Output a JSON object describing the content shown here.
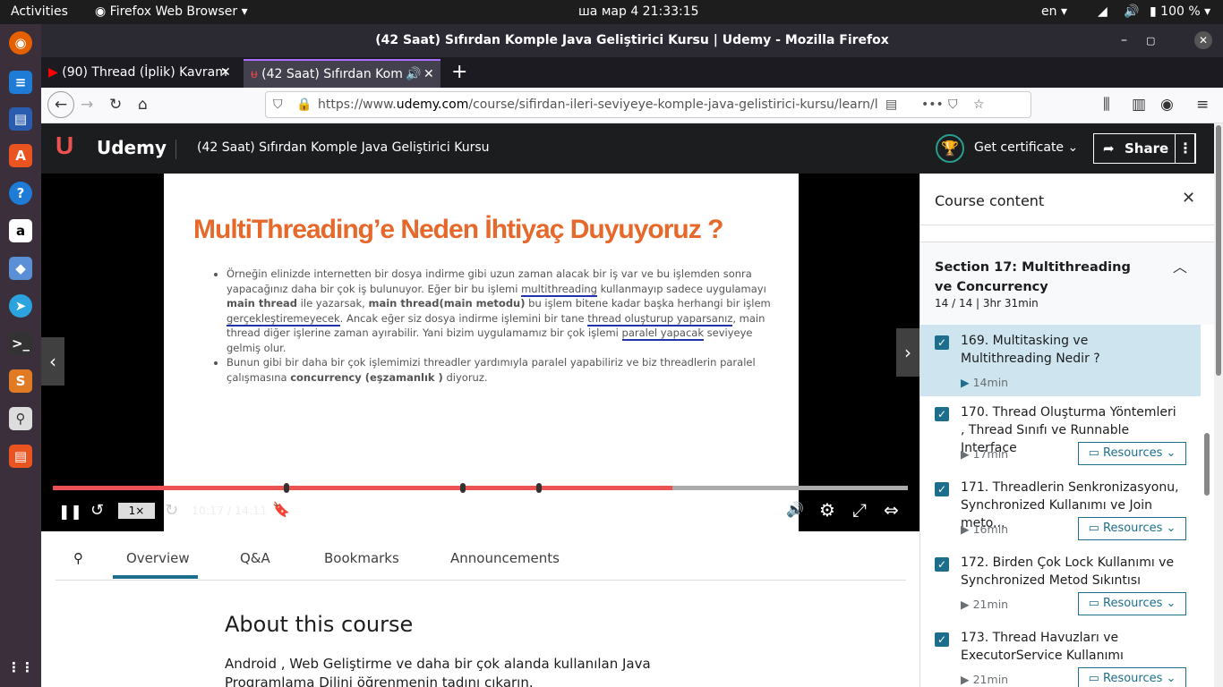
{
  "topbar": {
    "activities": "Activities",
    "app": "Firefox Web Browser",
    "datetime": "ша мар 4  21:33:15",
    "lang": "en",
    "battery": "100 %"
  },
  "window": {
    "title": "(42 Saat) Sıfırdan Komple Java Geliştirici Kursu | Udemy - Mozilla Firefox"
  },
  "tabs": [
    {
      "label": "(90) Thread (İplik) Kavram"
    },
    {
      "label": "(42 Saat) Sıfırdan Kom"
    }
  ],
  "url": {
    "prefix": "https://www.",
    "domain": "udemy.com",
    "path": "/course/sifirdan-ileri-seviyeye-komple-java-gelistirici-kursu/learn/l"
  },
  "udemy": {
    "logo": "Udemy",
    "course_title": "(42 Saat) Sıfırdan Komple Java Geliştirici Kursu",
    "certificate": "Get certificate",
    "share": "Share"
  },
  "slide": {
    "heading": "MultiThreading’e Neden İhtiyaç Duyuyoruz ?",
    "p1a": "Örneğin elinizde internetten bir dosya indirme gibi uzun zaman alacak bir iş var ve bu işlemden sonra yapacağınız daha bir çok iş bulunuyor. Eğer bir bu işlemi ",
    "p1b": "multithreading",
    "p1c": " kullanmayıp sadece uygulamayı ",
    "p1d": "main thread",
    "p1e": " ile yazarsak, ",
    "p1f": "main thread(main metodu)",
    "p1g": " bu işlem bitene kadar başka herhangi bir işlem ",
    "p1h": "gerçekleştiremeyecek",
    "p1i": ". Ancak eğer siz dosya indirme işlemini bir tane ",
    "p1j": "thread oluşturup yaparsanız",
    "p1k": ", main thread diğer işlerine zaman ayırabilir. Yani bizim uygulamamız bir çok işlemi ",
    "p1l": "paralel yapacak",
    "p1m": " seviyeye gelmiş olur.",
    "p2a": "Bunun gibi bir daha bir çok işlemimizi threadler yardımıyla paralel yapabiliriz ve biz threadlerin paralel çalışmasına ",
    "p2b": "concurrency (eşzamanlık )",
    "p2c": " diyoruz."
  },
  "player": {
    "speed": "1×",
    "time": "10:17 / 14:11",
    "progress": 0.725
  },
  "lower_tabs": {
    "overview": "Overview",
    "qa": "Q&A",
    "bookmarks": "Bookmarks",
    "announcements": "Announcements"
  },
  "about": {
    "title": "About this course",
    "text": "Android , Web Geliştirme ve daha bir çok alanda kullanılan Java Programlama Dilini öğrenmenin tadını çıkarın."
  },
  "sidebar": {
    "title": "Course content",
    "section_title": "Section 17: Multithreading ve Concurrency",
    "section_meta": "14 / 14 | 3hr 31min",
    "resources": "Resources",
    "lectures": [
      {
        "title": "169. Multitasking ve Multithreading Nedir ?",
        "duration": "14min"
      },
      {
        "title": "170. Thread Oluşturma Yöntemleri , Thread Sınıfı ve Runnable Interface",
        "duration": "17min"
      },
      {
        "title": "171. Threadlerin Senkronizasyonu, Synchronized Kullanımı ve Join meto...",
        "duration": "16min"
      },
      {
        "title": "172. Birden Çok Lock Kullanımı ve Synchronized Metod Sıkıntısı",
        "duration": "21min"
      },
      {
        "title": "173. Thread Havuzları ve ExecutorService Kullanımı",
        "duration": "21min"
      }
    ]
  }
}
